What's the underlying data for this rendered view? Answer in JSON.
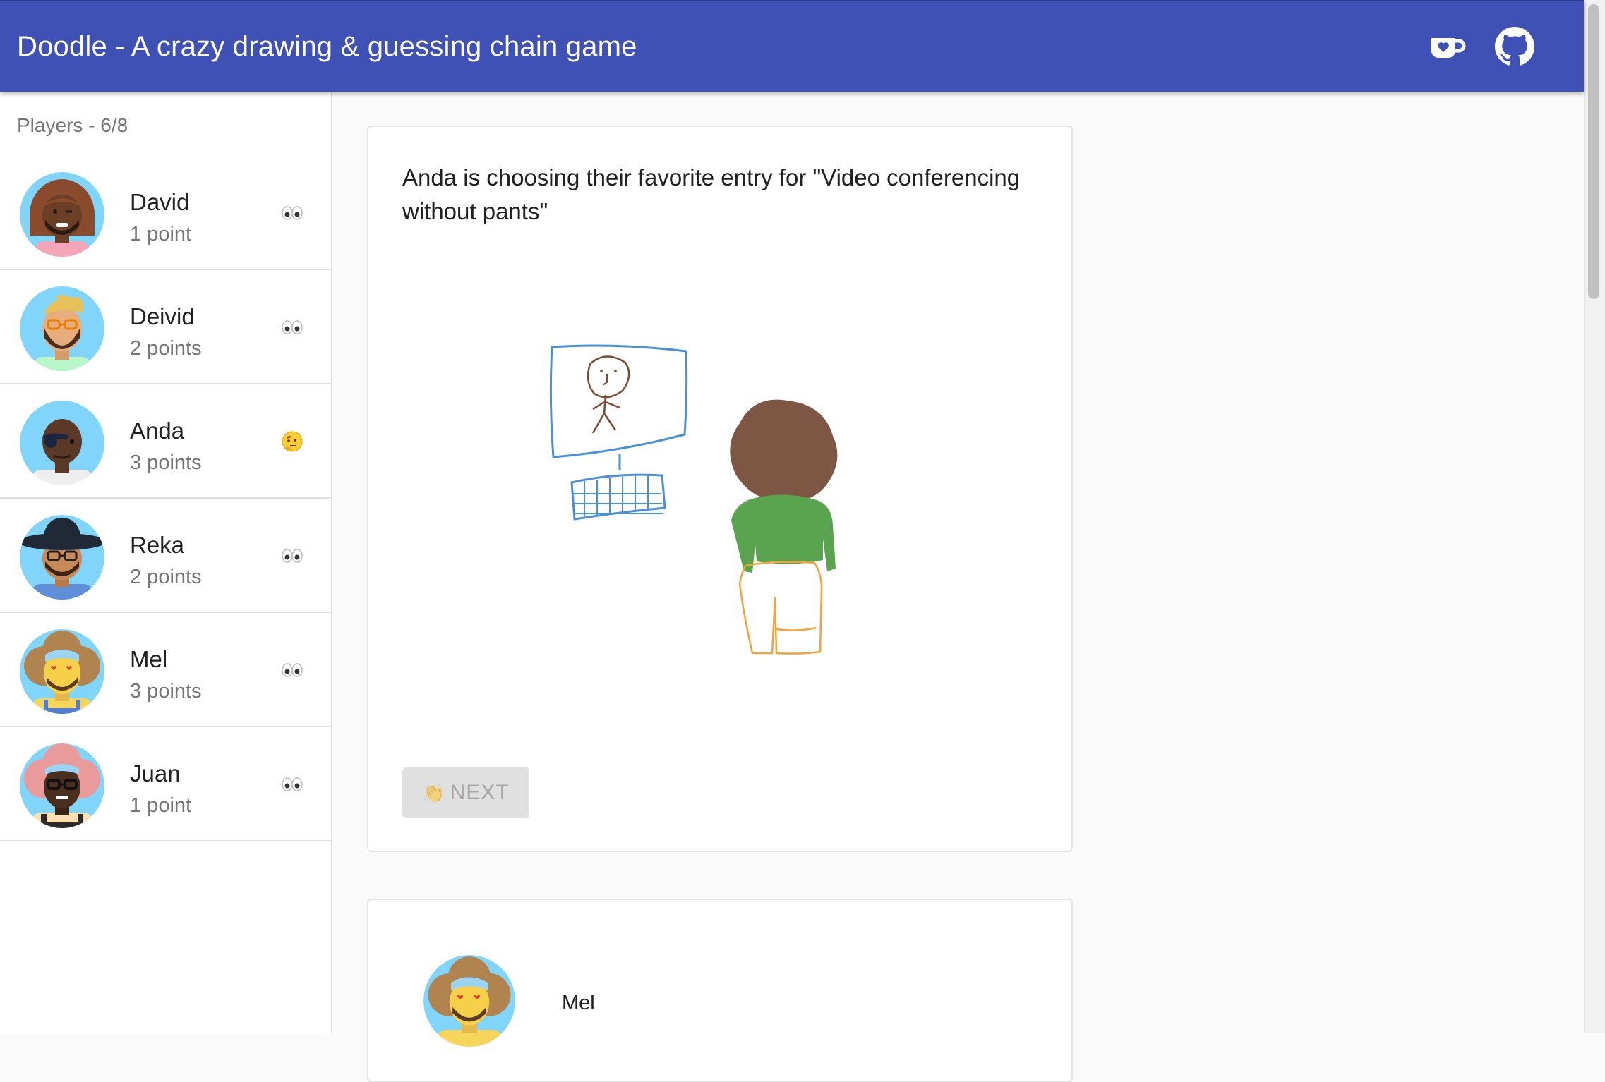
{
  "app": {
    "title": "Doodle - A crazy drawing & guessing chain game",
    "icons": [
      "ko-fi-cup-heart-icon",
      "github-icon"
    ]
  },
  "sidebar": {
    "header": "Players - 6/8",
    "players": [
      {
        "name": "David",
        "points": "1 point",
        "status": "eyes-emoji"
      },
      {
        "name": "Deivid",
        "points": "2 points",
        "status": "eyes-emoji"
      },
      {
        "name": "Anda",
        "points": "3 points",
        "status": "thinking-face-emoji"
      },
      {
        "name": "Reka",
        "points": "2 points",
        "status": "eyes-emoji"
      },
      {
        "name": "Mel",
        "points": "3 points",
        "status": "eyes-emoji"
      },
      {
        "name": "Juan",
        "points": "1 point",
        "status": "eyes-emoji"
      }
    ]
  },
  "main": {
    "prompt": "Anda is choosing their favorite entry for \"Video conferencing without pants\"",
    "next_button": "NEXT",
    "next_button_icon": "👏",
    "next_button_disabled": true,
    "entry": {
      "author": "Mel"
    }
  },
  "colors": {
    "appbar": "#3f51b5",
    "avatar_bg": "#81d4fa",
    "monitor_stroke": "#4a90d9",
    "figure_stroke": "#7b4a35",
    "hair_fill": "#7d5744",
    "shirt_fill": "#5aa44f",
    "pants_stroke": "#f0a43a"
  }
}
